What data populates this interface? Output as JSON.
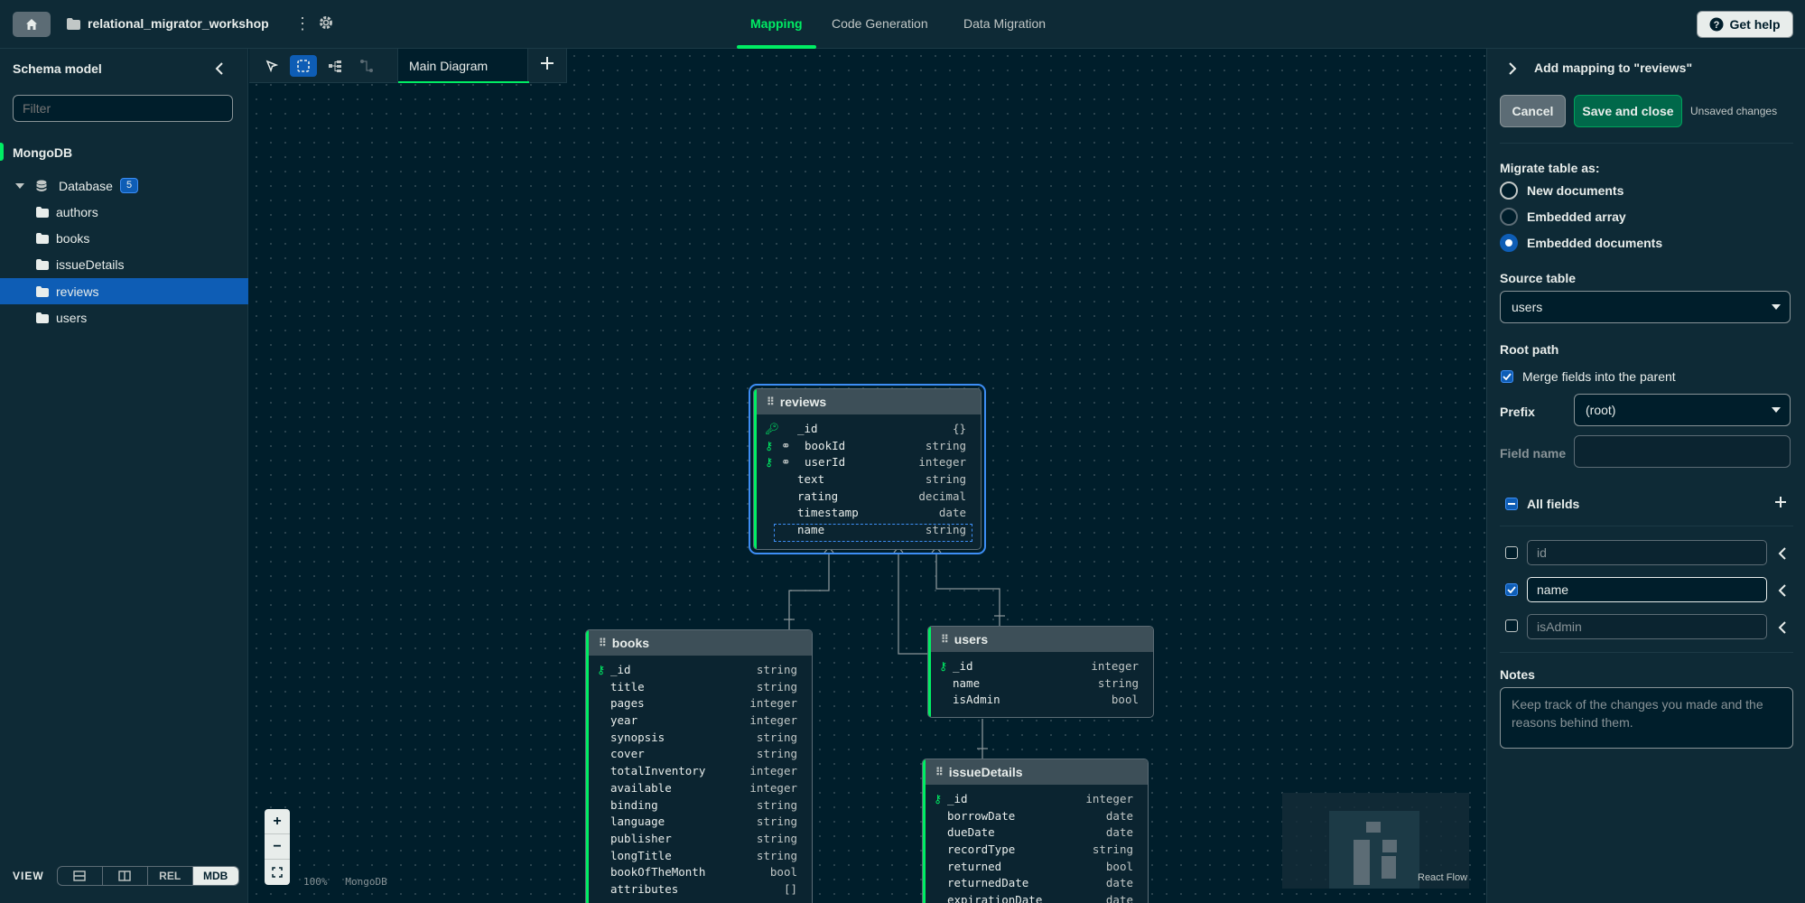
{
  "header": {
    "project_name": "relational_migrator_workshop",
    "tabs": [
      {
        "label": "Mapping",
        "active": true
      },
      {
        "label": "Code Generation",
        "active": false
      },
      {
        "label": "Data Migration",
        "active": false
      }
    ],
    "help_label": "Get help"
  },
  "sidebar": {
    "title": "Schema model",
    "filter_placeholder": "Filter",
    "section": "MongoDB",
    "database": {
      "label": "Database",
      "count": "5"
    },
    "collections": [
      "authors",
      "books",
      "issueDetails",
      "reviews",
      "users"
    ],
    "selected": "reviews",
    "view": {
      "label": "VIEW",
      "options": [
        "REL",
        "MDB"
      ],
      "active": "MDB"
    }
  },
  "canvas": {
    "diagram_tab": "Main Diagram",
    "zoom_label": "100%",
    "db_label": "MongoDB",
    "attribution": "React Flow",
    "zoom_controls": [
      "+",
      "−",
      "⛶"
    ]
  },
  "tables": {
    "reviews": {
      "name": "reviews",
      "fields": [
        {
          "name": "_id",
          "type": "{}"
        },
        {
          "name": "bookId",
          "type": "string"
        },
        {
          "name": "userId",
          "type": "integer"
        },
        {
          "name": "text",
          "type": "string"
        },
        {
          "name": "rating",
          "type": "decimal"
        },
        {
          "name": "timestamp",
          "type": "date"
        },
        {
          "name": "name",
          "type": "string"
        }
      ]
    },
    "books": {
      "name": "books",
      "fields": [
        {
          "name": "_id",
          "type": "string"
        },
        {
          "name": "title",
          "type": "string"
        },
        {
          "name": "pages",
          "type": "integer"
        },
        {
          "name": "year",
          "type": "integer"
        },
        {
          "name": "synopsis",
          "type": "string"
        },
        {
          "name": "cover",
          "type": "string"
        },
        {
          "name": "totalInventory",
          "type": "integer"
        },
        {
          "name": "available",
          "type": "integer"
        },
        {
          "name": "binding",
          "type": "string"
        },
        {
          "name": "language",
          "type": "string"
        },
        {
          "name": "publisher",
          "type": "string"
        },
        {
          "name": "longTitle",
          "type": "string"
        },
        {
          "name": "bookOfTheMonth",
          "type": "bool"
        },
        {
          "name": "attributes",
          "type": "[]"
        }
      ]
    },
    "users": {
      "name": "users",
      "fields": [
        {
          "name": "_id",
          "type": "integer"
        },
        {
          "name": "name",
          "type": "string"
        },
        {
          "name": "isAdmin",
          "type": "bool"
        }
      ]
    },
    "issueDetails": {
      "name": "issueDetails",
      "fields": [
        {
          "name": "_id",
          "type": "integer"
        },
        {
          "name": "borrowDate",
          "type": "date"
        },
        {
          "name": "dueDate",
          "type": "date"
        },
        {
          "name": "recordType",
          "type": "string"
        },
        {
          "name": "returned",
          "type": "bool"
        },
        {
          "name": "returnedDate",
          "type": "date"
        },
        {
          "name": "expirationDate",
          "type": "date"
        }
      ]
    }
  },
  "panel": {
    "title": "Add mapping to \"reviews\"",
    "cancel_label": "Cancel",
    "save_label": "Save and close",
    "unsaved": "Unsaved changes",
    "migrate_label": "Migrate table as:",
    "migrate_options": [
      "New documents",
      "Embedded array",
      "Embedded documents"
    ],
    "migrate_selected": "Embedded documents",
    "source_table_label": "Source table",
    "source_table_value": "users",
    "root_path_label": "Root path",
    "merge_label": "Merge fields into the parent",
    "merge_checked": true,
    "prefix_label": "Prefix",
    "prefix_value": "(root)",
    "field_name_label": "Field name",
    "field_name_value": "",
    "all_fields_label": "All fields",
    "fields": [
      {
        "name": "id",
        "checked": false
      },
      {
        "name": "name",
        "checked": true
      },
      {
        "name": "isAdmin",
        "checked": false
      }
    ],
    "notes_label": "Notes",
    "notes_placeholder": "Keep track of the changes you made and the reasons behind them."
  },
  "colors": {
    "accent": "#00ed64",
    "selection": "#0e5db5",
    "background": "#001e2b"
  }
}
